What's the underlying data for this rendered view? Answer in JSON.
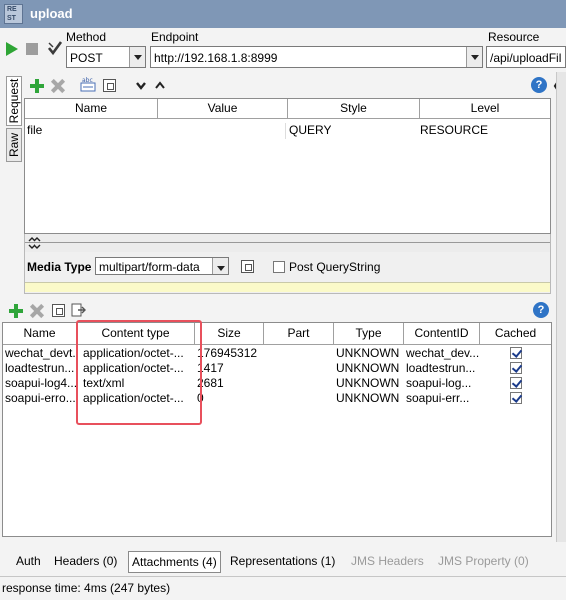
{
  "window": {
    "logo_text": [
      "RE",
      "ST"
    ],
    "title": "upload"
  },
  "request_bar": {
    "method_label": "Method",
    "method_value": "POST",
    "endpoint_label": "Endpoint",
    "endpoint_value": "http://192.168.1.8:8999",
    "resource_label": "Resource",
    "resource_value": "/api/uploadFil"
  },
  "side_tabs": {
    "request": "Request",
    "raw": "Raw"
  },
  "params_table": {
    "columns": [
      "Name",
      "Value",
      "Style",
      "Level"
    ],
    "rows": [
      {
        "name": "file",
        "value": "",
        "style": "QUERY",
        "level": "RESOURCE"
      }
    ]
  },
  "media": {
    "label": "Media Type",
    "value": "multipart/form-data",
    "post_querystring_label": "Post QueryString",
    "post_querystring_checked": false
  },
  "attachments_table": {
    "columns": [
      "Name",
      "Content type",
      "Size",
      "Part",
      "Type",
      "ContentID",
      "Cached"
    ],
    "rows": [
      {
        "name": "wechat_devt...",
        "content_type": "application/octet-...",
        "size": "176945312",
        "part": "",
        "type": "UNKNOWN",
        "content_id": "wechat_dev...",
        "cached": true
      },
      {
        "name": "loadtestrun...",
        "content_type": "application/octet-...",
        "size": "1417",
        "part": "",
        "type": "UNKNOWN",
        "content_id": "loadtestrun...",
        "cached": true
      },
      {
        "name": "soapui-log4...",
        "content_type": "text/xml",
        "size": "2681",
        "part": "",
        "type": "UNKNOWN",
        "content_id": "soapui-log...",
        "cached": true
      },
      {
        "name": "soapui-erro...",
        "content_type": "application/octet-...",
        "size": "0",
        "part": "",
        "type": "UNKNOWN",
        "content_id": "soapui-err...",
        "cached": true
      }
    ]
  },
  "bottom_tabs": {
    "auth": "Auth",
    "headers": "Headers (0)",
    "attachments": "Attachments (4)",
    "representations": "Representations (1)",
    "jms_headers": "JMS Headers",
    "jms_property": "JMS Property (0)"
  },
  "status": {
    "response_time": "response time: 4ms (247 bytes)"
  },
  "colors": {
    "titlebar": "#7f97b6",
    "highlight": "#e8505c",
    "accent_green": "#2fa53a",
    "help_blue": "#2f74c6"
  },
  "icons": [
    "play-icon",
    "stop-icon",
    "checkmark-icon",
    "add-icon",
    "delete-icon",
    "help-icon"
  ]
}
